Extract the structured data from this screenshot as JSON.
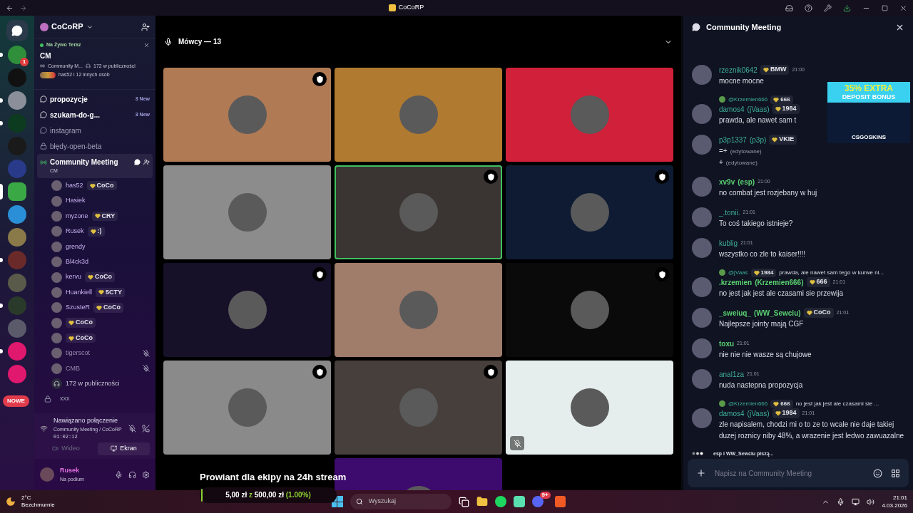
{
  "window": {
    "title": "CoCoRP"
  },
  "rail": {
    "servers": [
      {
        "color": "#2f8f3a",
        "pill": true,
        "selected": false,
        "badge": "1"
      },
      {
        "color": "#111111",
        "pill": false,
        "selected": false
      },
      {
        "color": "#8a8f99",
        "pill": true,
        "selected": false
      },
      {
        "color": "#0d3b1f",
        "pill": true,
        "selected": false
      },
      {
        "color": "#1a1a1a",
        "pill": false,
        "selected": false
      },
      {
        "color": "#2a3a8a",
        "pill": false,
        "selected": false
      },
      {
        "color": "#3aa845",
        "pill": false,
        "selected": true
      },
      {
        "color": "#2a8fd6",
        "pill": false,
        "selected": false
      },
      {
        "color": "#8a7a4a",
        "pill": false,
        "selected": false
      },
      {
        "color": "#6a2a2a",
        "pill": true,
        "selected": false
      },
      {
        "color": "#5a5a4a",
        "pill": false,
        "selected": false
      },
      {
        "color": "#2a3a2a",
        "pill": true,
        "selected": false
      },
      {
        "color": "#5a5a6a",
        "pill": false,
        "selected": false
      },
      {
        "color": "#e0186e",
        "pill": true,
        "selected": false
      },
      {
        "color": "#e0186e",
        "pill": false,
        "selected": false
      }
    ],
    "new_badge": "NOWE"
  },
  "server": {
    "name": "CoCoRP",
    "live": {
      "label": "Na Żywo Teraz",
      "title": "CM",
      "channel": "Community M...",
      "audience": "172 w publiczności",
      "listeners": "has52 i 12 innych osób"
    },
    "channels": [
      {
        "kind": "forum",
        "name": "propozycje",
        "count": "3 New",
        "unread": true
      },
      {
        "kind": "forum",
        "name": "szukam-do-g...",
        "count": "3 New",
        "unread": true
      },
      {
        "kind": "forum",
        "name": "instagram",
        "unread": false
      },
      {
        "kind": "locked",
        "name": "błędy-open-beta",
        "unread": false
      }
    ],
    "stage": {
      "name": "Community Meeting",
      "topic": "CM",
      "selected": true
    },
    "members": [
      {
        "name": "has52",
        "tag": "CoCo",
        "muted": false
      },
      {
        "name": "Hasiek",
        "muted": false
      },
      {
        "name": "myzone",
        "tag": "CRY",
        "muted": false
      },
      {
        "name": "Rusek",
        "tag": ":)",
        "muted": false
      },
      {
        "name": "grendy",
        "muted": false
      },
      {
        "name": "Bl4ck3d",
        "muted": false
      },
      {
        "name": "kervu",
        "tag": "CoCo",
        "muted": false
      },
      {
        "name": "Huankiell",
        "tag": "5CTY",
        "muted": false
      },
      {
        "name": "SzusteR",
        "tag": "CoCo",
        "muted": false
      },
      {
        "tag": "CoCo",
        "muted": false
      },
      {
        "tag": "CoCo",
        "muted": false
      },
      {
        "name": "tigerscot",
        "muted": true
      },
      {
        "name": "CMB",
        "muted": true
      }
    ],
    "audience_row": "172 w publiczności",
    "extra_channel": {
      "kind": "locked",
      "name": "xxx"
    }
  },
  "voice": {
    "status": "Nawiązano połączenie",
    "location": "Community Meeting / CoCoRP",
    "timer": "01:02:12",
    "buttons": [
      {
        "label": "Wideo",
        "disabled": true
      },
      {
        "label": "Ekran",
        "disabled": false
      }
    ]
  },
  "user": {
    "name": "Rusek",
    "status": "Na podium"
  },
  "stage_view": {
    "header": "Mówcy — 13",
    "tiles": [
      {
        "color": "#b07a55",
        "moderator": true,
        "speaking": false,
        "muted": false
      },
      {
        "color": "#b07a30",
        "moderator": false,
        "speaking": false,
        "muted": false
      },
      {
        "color": "#d0203a",
        "moderator": false,
        "speaking": false,
        "muted": false
      },
      {
        "color": "#8c8c8c",
        "moderator": false,
        "speaking": false,
        "muted": false
      },
      {
        "color": "#3a3532",
        "moderator": true,
        "speaking": true,
        "muted": false
      },
      {
        "color": "#0e1b33",
        "moderator": true,
        "speaking": false,
        "muted": false
      },
      {
        "color": "#161028",
        "moderator": true,
        "speaking": false,
        "muted": false
      },
      {
        "color": "#a07c6a",
        "moderator": false,
        "speaking": false,
        "muted": false
      },
      {
        "color": "#0a0a0a",
        "moderator": true,
        "speaking": false,
        "muted": false
      },
      {
        "color": "#8a8a8a",
        "moderator": true,
        "speaking": false,
        "muted": false
      },
      {
        "color": "#463f3c",
        "moderator": true,
        "speaking": false,
        "muted": false
      },
      {
        "color": "#e5eeec",
        "moderator": false,
        "speaking": false,
        "muted": true
      },
      {
        "color": "#3d0a6e"
      }
    ]
  },
  "goal": {
    "title": "Prowiant dla ekipy na 24h stream",
    "raised": "5,00 zł",
    "sep": "z",
    "target": "500,00 zł",
    "percent": "(1.00%)",
    "level": 0.01
  },
  "chat": {
    "title": "Community Meeting",
    "messages": [
      {
        "author": "rzeznik0642",
        "bold": false,
        "tag": "BMW",
        "time": "21:00",
        "lines": [
          {
            "text": "mocne mocne"
          }
        ]
      },
      {
        "author": "damos4",
        "nick": "(jVaas)",
        "bold": false,
        "tag": "1984",
        "reply": {
          "author": "@Krzemien666",
          "tag": "666"
        },
        "lines": [
          {
            "text": "prawda, ale nawet sam t"
          }
        ]
      },
      {
        "author": "p3p1337",
        "nick": "(p3p)",
        "bold": false,
        "tag": "VKIE",
        "lines": [
          {
            "text": "=+",
            "note": "(edytowane)"
          },
          {
            "text": "+",
            "note": "(edytowane)"
          }
        ]
      },
      {
        "author": "xv9v",
        "nick": "(esp)",
        "bold": true,
        "time": "21:00",
        "lines": [
          {
            "text": "no combat jest rozjebany w huj"
          }
        ]
      },
      {
        "author": "_.tonii.",
        "bold": false,
        "time": "21:01",
        "lines": [
          {
            "text": "To coś takiego istnieje?"
          }
        ]
      },
      {
        "author": "kublig",
        "bold": false,
        "time": "21:01",
        "lines": [
          {
            "text": "wszystko co zle to kaiser!!!!"
          }
        ]
      },
      {
        "author": ".krzemien",
        "nick": "(Krzemien666)",
        "bold": true,
        "tag": "666",
        "time": "21:01",
        "reply": {
          "author": "@jVaas",
          "tag": "1984",
          "text": "prawda, ale nawet sam tego w kurwe ni..."
        },
        "lines": [
          {
            "text": "no jest jak jest ale czasami sie przewija"
          }
        ]
      },
      {
        "author": "_sweiuq_",
        "nick": "(WW_Sewciu)",
        "bold": true,
        "tag": "CoCo",
        "time": "21:01",
        "lines": [
          {
            "text": "Najlepsze jointy mają CGF"
          }
        ]
      },
      {
        "author": "toxu",
        "bold": true,
        "time": "21:01",
        "lines": [
          {
            "text": "nie nie nie wasze są chujowe"
          }
        ]
      },
      {
        "author": "anal1za",
        "bold": false,
        "time": "21:01",
        "lines": [
          {
            "text": "nuda nastepna propozycja"
          }
        ]
      },
      {
        "author": "damos4",
        "nick": "(jVaas)",
        "bold": false,
        "tag": "1984",
        "time": "21:01",
        "reply": {
          "author": "@Krzemien666",
          "tag": "666",
          "text": "no jest jak jest ale czasami sie ..."
        },
        "lines": [
          {
            "text": "zle napisalem, chodzi mi o to ze to wcale nie daje takiej duzej roznicy niby 48%, a wrazenie jest ledwo zawuazalne"
          }
        ]
      }
    ],
    "typing": "esp i WW_Sewciu piszą...",
    "composer": {
      "placeholder": "Napisz na Community Meeting"
    },
    "ad": {
      "line1": "35% EXTRA",
      "line2": "DEPOSIT BONUS",
      "brand": "CSGOSKINS"
    }
  },
  "taskbar": {
    "weather": {
      "temp": "2°C",
      "desc": "Bezchmurnie"
    },
    "search": {
      "placeholder": "Wyszukaj"
    },
    "discord_badge": "9+",
    "time": "21:01",
    "date": "4.03.2026"
  }
}
